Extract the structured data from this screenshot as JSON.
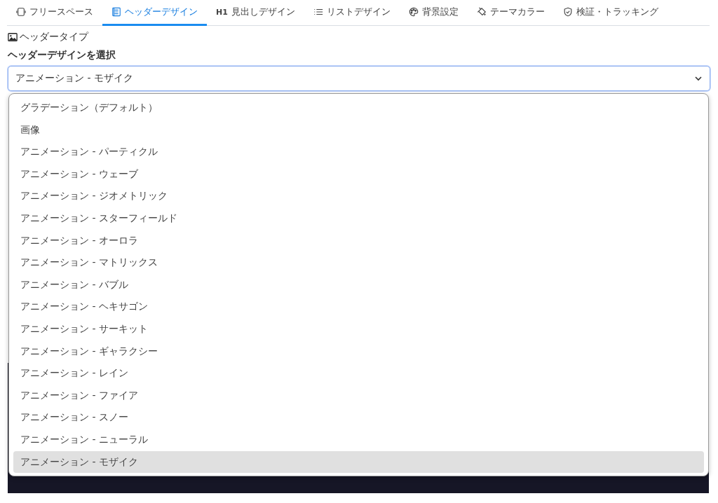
{
  "tabs": [
    {
      "kind": "frame",
      "label": "フリースペース",
      "selected": false
    },
    {
      "kind": "document",
      "label": "ヘッダーデザイン",
      "selected": true
    },
    {
      "kind": "badge",
      "badge": "H1",
      "label": "見出しデザイン",
      "selected": false
    },
    {
      "kind": "list",
      "label": "リストデザイン",
      "selected": false
    },
    {
      "kind": "palette",
      "label": "背景設定",
      "selected": false
    },
    {
      "kind": "paint",
      "label": "テーマカラー",
      "selected": false
    },
    {
      "kind": "shield",
      "label": "検証・トラッキング",
      "selected": false
    }
  ],
  "section": {
    "title": "ヘッダータイプ"
  },
  "select": {
    "label": "ヘッダーデザインを選択",
    "value": "アニメーション - モザイク",
    "expanded": true,
    "options": [
      {
        "label": "グラデーション（デフォルト）",
        "selected": false
      },
      {
        "label": "画像",
        "selected": false
      },
      {
        "label": "アニメーション - パーティクル",
        "selected": false
      },
      {
        "label": "アニメーション - ウェーブ",
        "selected": false
      },
      {
        "label": "アニメーション - ジオメトリック",
        "selected": false
      },
      {
        "label": "アニメーション - スターフィールド",
        "selected": false
      },
      {
        "label": "アニメーション - オーロラ",
        "selected": false
      },
      {
        "label": "アニメーション - マトリックス",
        "selected": false
      },
      {
        "label": "アニメーション - バブル",
        "selected": false
      },
      {
        "label": "アニメーション - ヘキサゴン",
        "selected": false
      },
      {
        "label": "アニメーション - サーキット",
        "selected": false
      },
      {
        "label": "アニメーション - ギャラクシー",
        "selected": false
      },
      {
        "label": "アニメーション - レイン",
        "selected": false
      },
      {
        "label": "アニメーション - ファイア",
        "selected": false
      },
      {
        "label": "アニメーション - スノー",
        "selected": false
      },
      {
        "label": "アニメーション - ニューラル",
        "selected": false
      },
      {
        "label": "アニメーション - モザイク",
        "selected": true
      }
    ]
  }
}
